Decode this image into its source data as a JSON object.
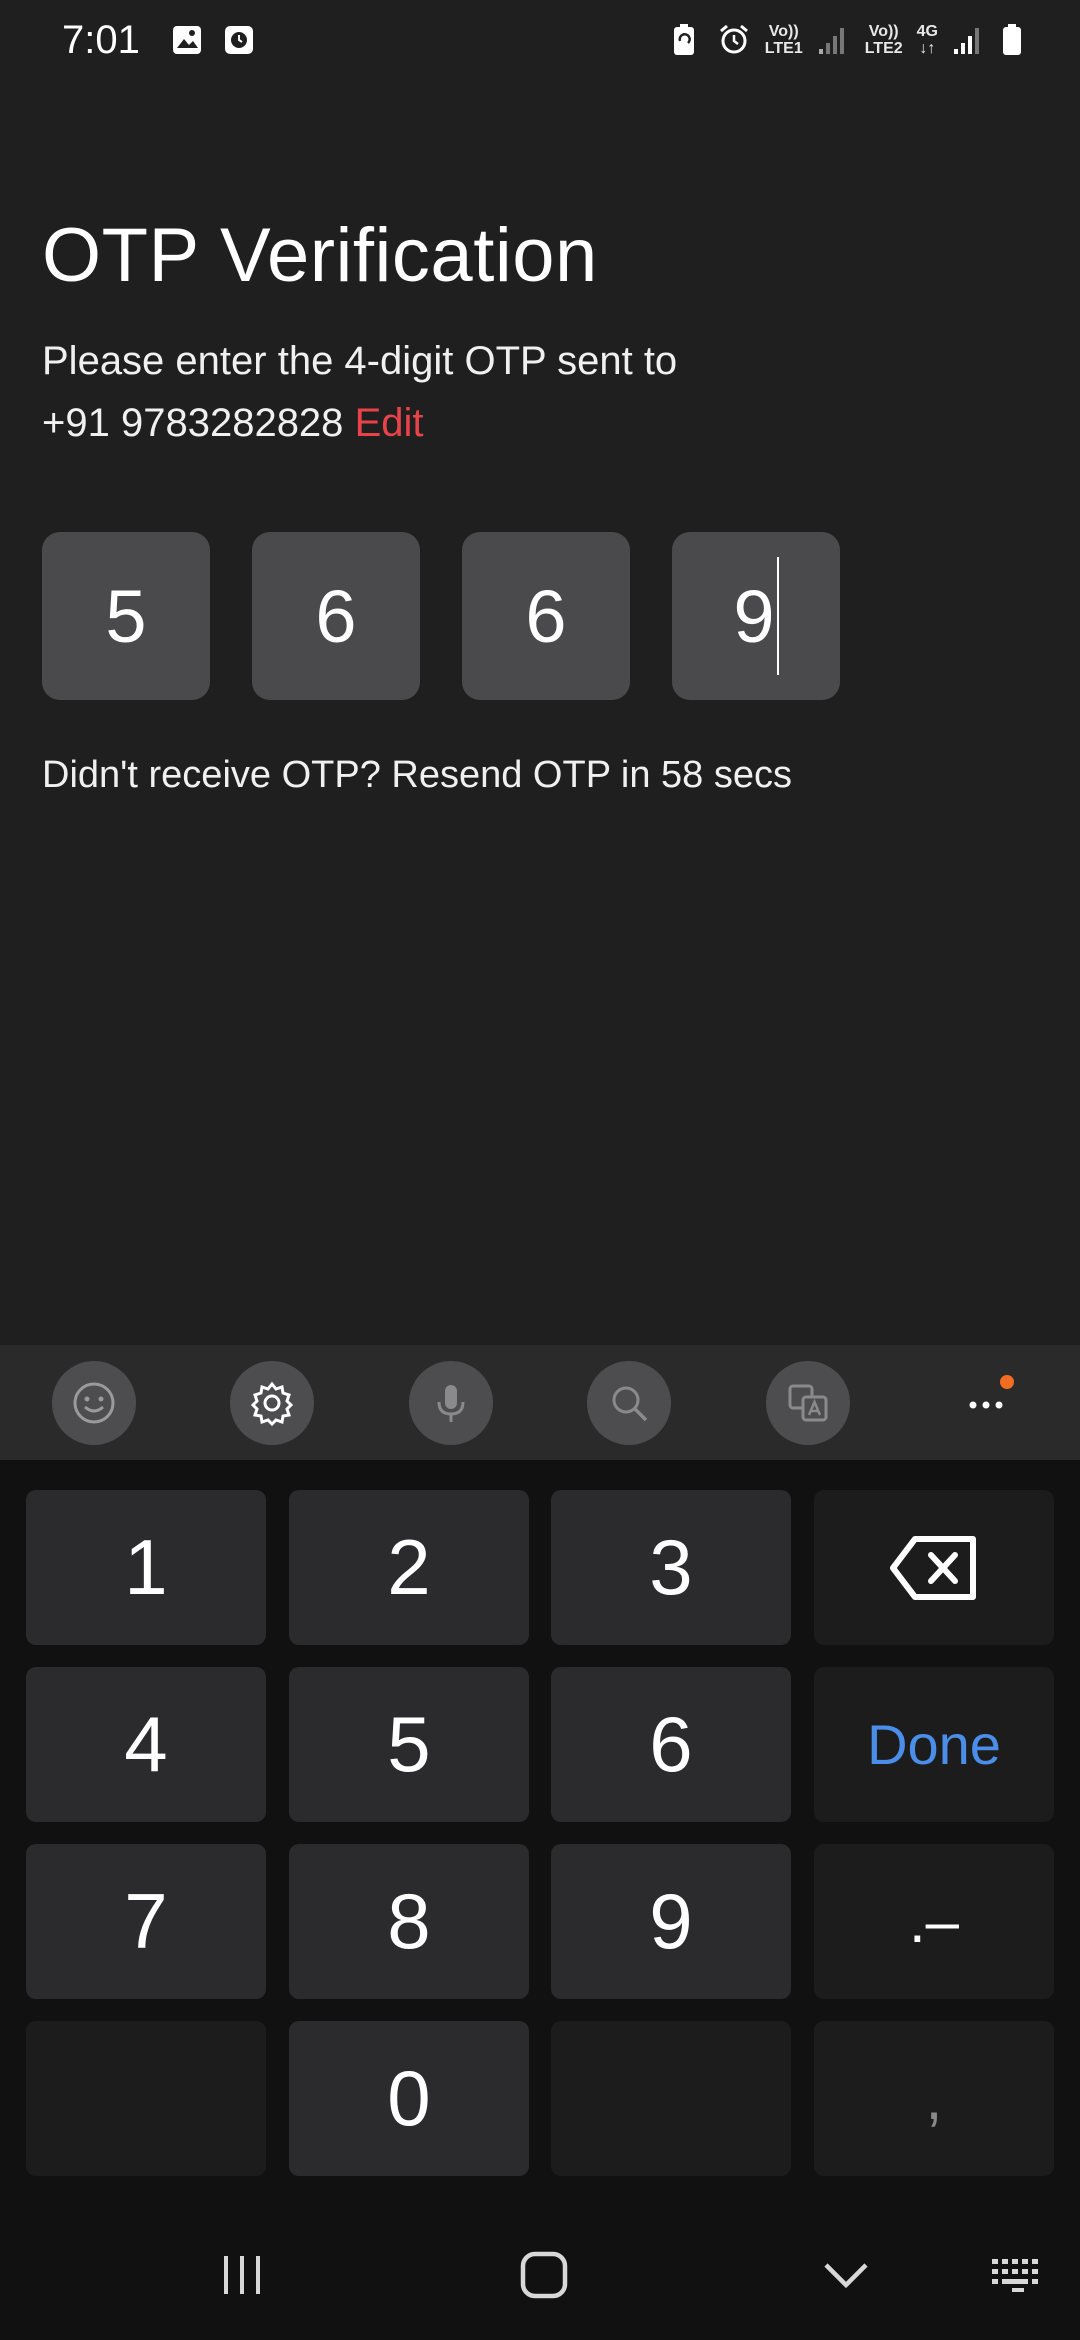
{
  "status_bar": {
    "time": "7:01",
    "net1_top": "Vo))",
    "net1_bottom": "LTE1",
    "net2_top": "Vo))",
    "net2_bottom": "LTE2",
    "net3_top": "4G",
    "icons": [
      "gallery-icon",
      "clock-app-icon",
      "battery-saver-icon",
      "alarm-icon",
      "signal-icon",
      "battery-icon"
    ]
  },
  "page": {
    "title": "OTP Verification",
    "subtitle_line1": "Please enter the 4-digit OTP sent to",
    "phone": "+91 9783282828",
    "edit_label": "Edit",
    "otp_digits": [
      "5",
      "6",
      "6",
      "9"
    ],
    "resend_text": "Didn't receive OTP? Resend OTP in 58 secs"
  },
  "keyboard": {
    "toolbar": [
      "emoji-icon",
      "settings-icon",
      "microphone-icon",
      "search-icon",
      "translate-icon",
      "more-icon"
    ],
    "keys": {
      "k1": "1",
      "k2": "2",
      "k3": "3",
      "k4": "4",
      "k5": "5",
      "k6": "6",
      "k7": "7",
      "k8": "8",
      "k9": "9",
      "k0": "0",
      "done": "Done",
      "punct": ".–",
      "comma": ","
    }
  },
  "colors": {
    "background": "#1f1f20",
    "accent_edit": "#e9434a",
    "done_blue": "#4b8ee9",
    "notification_dot": "#f26d21"
  }
}
